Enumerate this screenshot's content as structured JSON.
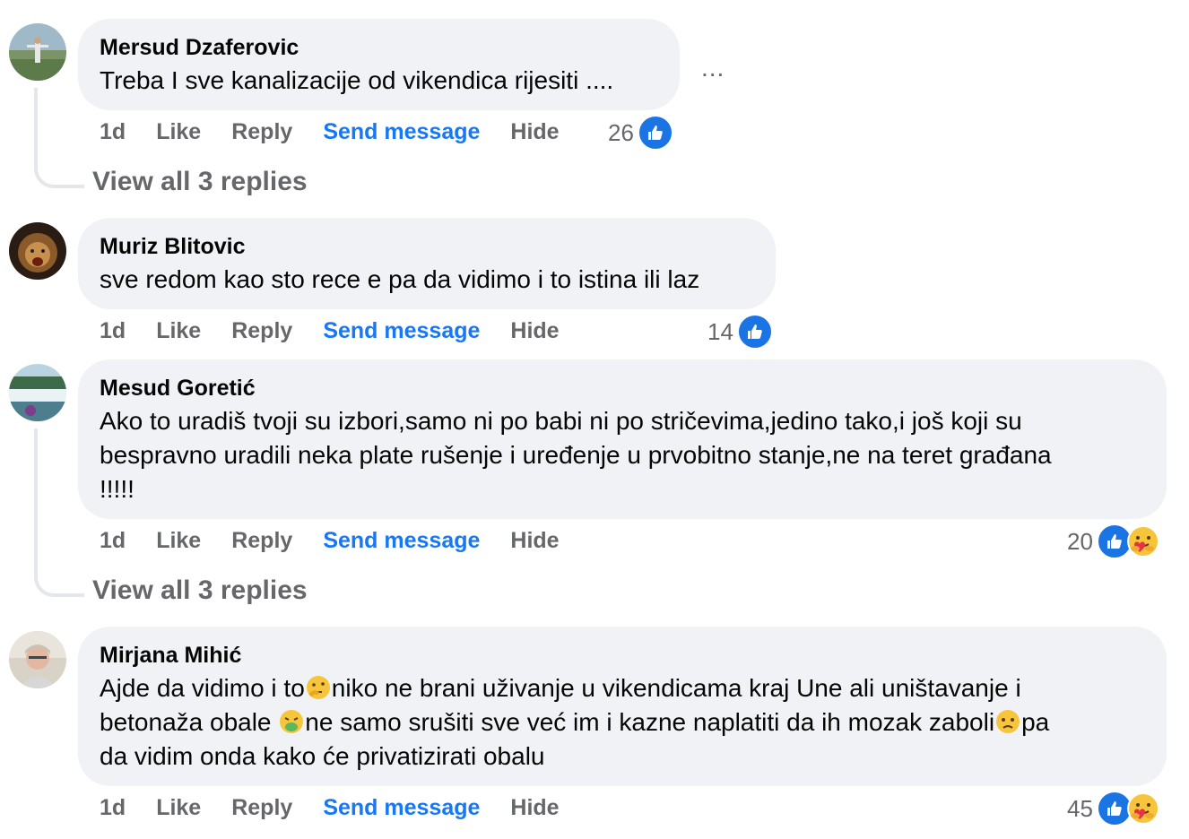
{
  "actions": {
    "time": "1d",
    "like": "Like",
    "reply": "Reply",
    "send": "Send message",
    "hide": "Hide"
  },
  "more_label": "...",
  "comments": [
    {
      "author": "Mersud Dzaferovic",
      "text": "Treba I sve kanalizacije od vikendica rijesiti ....",
      "reaction_count": "26",
      "view_replies": "View all 3 replies"
    },
    {
      "author": "Muriz Blitovic",
      "text": "sve redom kao sto rece e pa da vidimo i to istina ili laz",
      "reaction_count": "14"
    },
    {
      "author": "Mesud Goretić",
      "text_lines": [
        "Ako to uradiš tvoji su izbori,samo ni po babi ni po stričevima,jedino tako,i još koji su",
        "bespravno uradili neka plate rušenje i uređenje u prvobitno stanje,ne na teret građana",
        "!!!!!"
      ],
      "reaction_count": "20",
      "view_replies": "View all 3 replies"
    },
    {
      "author": "Mirjana Mihić",
      "line1_a": "Ajde da vidimo i to",
      "line1_b": "niko ne brani uživanje u vikendicama kraj Une ali uništavanje i",
      "line2_a": "betonaža obale ",
      "line2_b": "ne samo srušiti sve već im i kazne naplatiti da ih mozak zaboli",
      "line2_c": "pa",
      "line3": "da vidim onda kako će privatizirati obalu",
      "reaction_count": "45"
    }
  ],
  "colors": {
    "like_blue": "#1b74e4",
    "link_blue": "#1877f2",
    "bubble": "#f0f2f5",
    "meta_gray": "#65676b"
  }
}
